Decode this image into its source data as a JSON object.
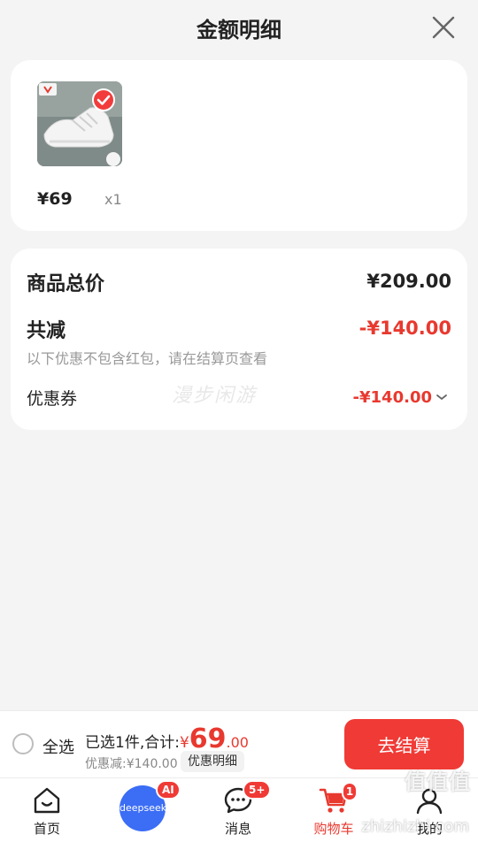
{
  "header": {
    "title": "金额明细",
    "close_icon": "close-icon"
  },
  "product": {
    "thumb_logo": "乔丹",
    "price": "¥69",
    "quantity": "x1",
    "selected_icon": "check-icon"
  },
  "summary": {
    "total_label": "商品总价",
    "total_value": "¥209.00",
    "reduce_label": "共减",
    "reduce_value": "-¥140.00",
    "reduce_note": "以下优惠不包含红包，请在结算页查看",
    "coupon_label": "优惠券",
    "coupon_value": "-¥140.00",
    "watermark": "漫步闲游"
  },
  "checkout": {
    "select_all_label": "全选",
    "selected_prefix": "已选1件,合计:",
    "sum_yen": "¥",
    "sum_int": "69",
    "sum_dec": ".00",
    "discount_text": "优惠减:¥140.00",
    "detail_pill": "优惠明细",
    "button_label": "去结算"
  },
  "tabbar": {
    "home": "首页",
    "ai_text": "deepseek",
    "ai_badge": "AI",
    "messages": "消息",
    "messages_badge": "5+",
    "cart": "购物车",
    "cart_badge": "1",
    "me": "我的"
  },
  "overlay": {
    "site_mark": "值值值",
    "site_url": "zhizhizhi.com"
  },
  "colors": {
    "accent": "#f03a35",
    "background": "#f4f4f4",
    "ai_blue": "#3b6df5"
  }
}
